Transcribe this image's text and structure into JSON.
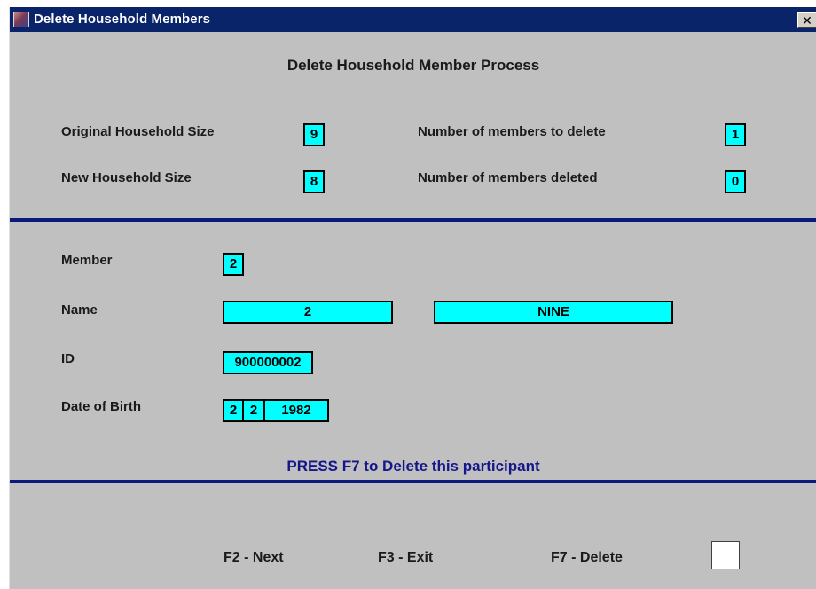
{
  "window": {
    "title": "Delete Household Members",
    "close_glyph": "✕"
  },
  "heading": "Delete Household Member Process",
  "counts": {
    "original_size_label": "Original Household Size",
    "original_size_value": "9",
    "new_size_label": "New Household Size",
    "new_size_value": "8",
    "to_delete_label": "Number of members to delete",
    "to_delete_value": "1",
    "deleted_label": "Number of members deleted",
    "deleted_value": "0"
  },
  "member": {
    "member_label": "Member",
    "member_value": "2",
    "name_label": "Name",
    "first_name": "2",
    "last_name": "NINE",
    "id_label": "ID",
    "id_value": "900000002",
    "dob_label": "Date of Birth",
    "dob_month": "2",
    "dob_day": "2",
    "dob_year": "1982"
  },
  "prompt": "PRESS F7 to Delete this participant",
  "footer": {
    "f2": "F2 - Next",
    "f3": "F3 - Exit",
    "f7": "F7 - Delete"
  },
  "colors": {
    "field_bg": "#00ffff",
    "window_bg": "#c0c0c0",
    "titlebar": "#0a246a",
    "divider": "#0a1a7a",
    "prompt_text": "#14168a"
  },
  "icons": {
    "app": "app-icon",
    "close": "close-icon"
  }
}
